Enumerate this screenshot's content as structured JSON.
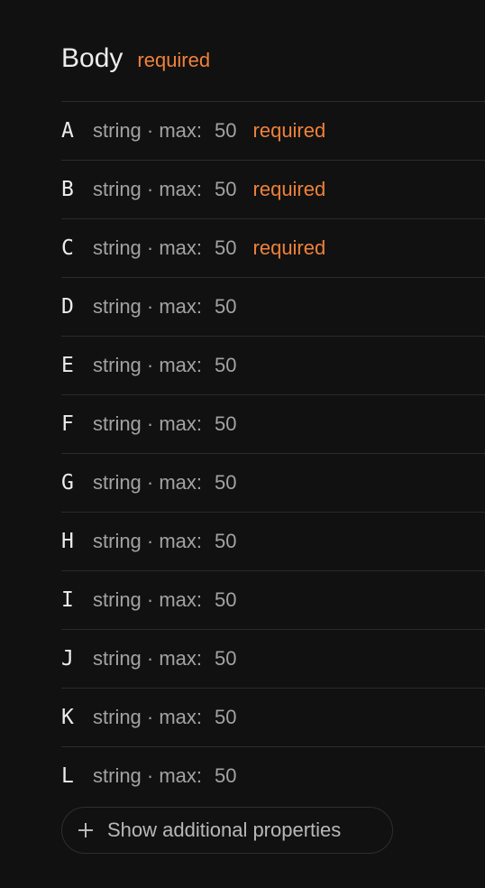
{
  "header": {
    "title": "Body",
    "required_label": "required"
  },
  "properties": [
    {
      "name": "A",
      "type": "string · max:",
      "max": "50",
      "required": "required"
    },
    {
      "name": "B",
      "type": "string · max:",
      "max": "50",
      "required": "required"
    },
    {
      "name": "C",
      "type": "string · max:",
      "max": "50",
      "required": "required"
    },
    {
      "name": "D",
      "type": "string · max:",
      "max": "50"
    },
    {
      "name": "E",
      "type": "string · max:",
      "max": "50"
    },
    {
      "name": "F",
      "type": "string · max:",
      "max": "50"
    },
    {
      "name": "G",
      "type": "string · max:",
      "max": "50"
    },
    {
      "name": "H",
      "type": "string · max:",
      "max": "50"
    },
    {
      "name": "I",
      "type": "string · max:",
      "max": "50"
    },
    {
      "name": "J",
      "type": "string · max:",
      "max": "50"
    },
    {
      "name": "K",
      "type": "string · max:",
      "max": "50"
    },
    {
      "name": "L",
      "type": "string · max:",
      "max": "50"
    }
  ],
  "show_more": {
    "label": "Show additional properties",
    "icon": "plus-icon"
  },
  "colors": {
    "accent": "#f0813a",
    "background": "#111111"
  }
}
